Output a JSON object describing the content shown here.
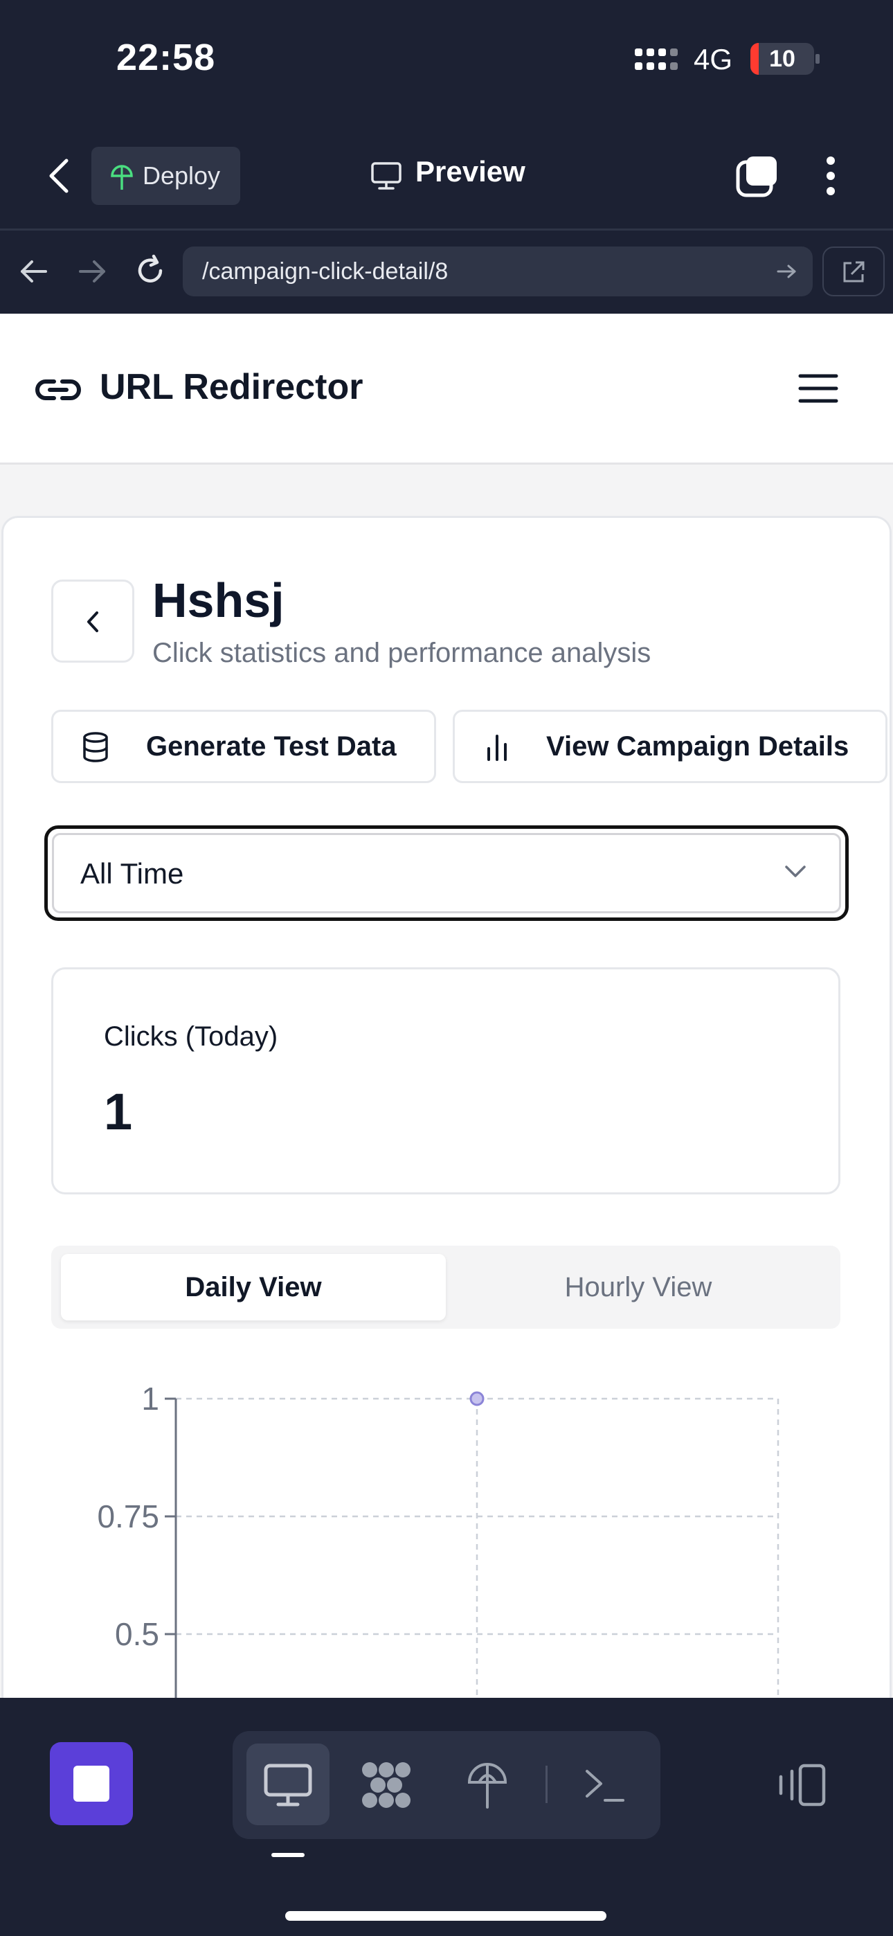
{
  "status_bar": {
    "time": "22:58",
    "network": "4G",
    "battery": "10"
  },
  "browser_chrome": {
    "deploy_label": "Deploy",
    "preview_label": "Preview",
    "url": "/campaign-click-detail/8"
  },
  "app": {
    "brand": "URL Redirector",
    "page_title": "Hshsj",
    "page_subtitle": "Click statistics and performance analysis",
    "actions": {
      "generate_label": "Generate Test Data",
      "details_label": "View Campaign Details"
    },
    "date_filter": {
      "selected": "All Time"
    },
    "stats": {
      "label": "Clicks (Today)",
      "value": "1"
    },
    "tabs": {
      "daily": "Daily View",
      "hourly": "Hourly View"
    }
  },
  "chart_data": {
    "type": "line",
    "x": [
      "",
      "",
      ""
    ],
    "series": [
      {
        "values": [
          null,
          1,
          null
        ]
      }
    ],
    "yticks": [
      "1",
      "0.75",
      "0.5"
    ],
    "ylim": [
      0,
      1
    ],
    "grid": true,
    "point_color": "#8b84d7"
  },
  "colors": {
    "chrome_bg": "#1c2133",
    "accent_purple": "#5b3fd9",
    "battery_red": "#ff3b30"
  }
}
